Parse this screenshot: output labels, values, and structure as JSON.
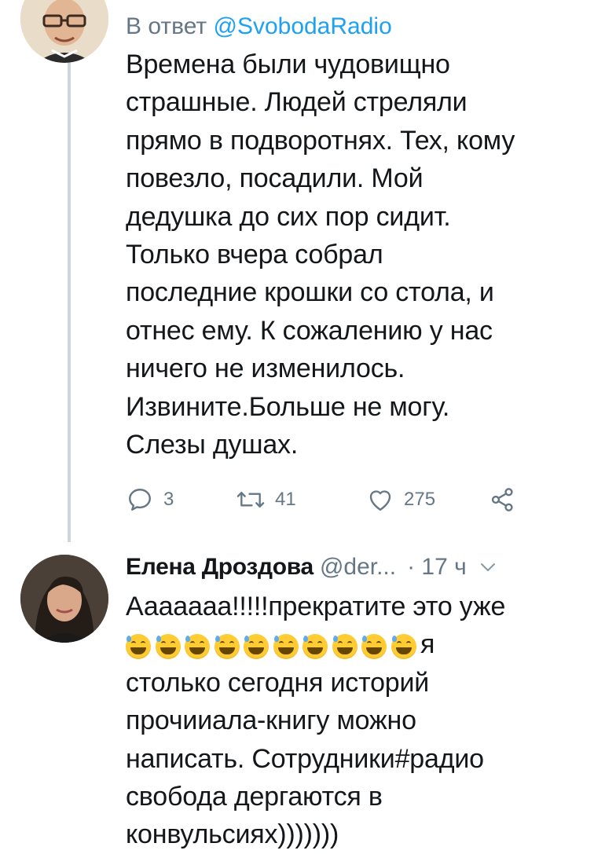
{
  "tweet1": {
    "reply_prefix": "В ответ",
    "reply_mention": "@SvobodaRadio",
    "lines": [
      "Времена были чудовищно",
      "страшные. Людей стреляли",
      "прямо в подворотнях. Тех, кому",
      "повезло, посадили. Мой",
      "дедушка до сих пор сидит.",
      "Только вчера собрал",
      "последние крошки со стола, и",
      "отнес ему. К сожалению у нас",
      "ничего не изменилось.",
      "Извините.Больше не могу.",
      "Слезы душах."
    ],
    "actions": {
      "reply_count": "3",
      "retweet_count": "41",
      "like_count": "275"
    },
    "icons": [
      "avatar-photo",
      "reply-icon",
      "retweet-icon",
      "like-icon",
      "share-icon"
    ]
  },
  "tweet2": {
    "author_name": "Елена Дроздова",
    "author_handle": "@der...",
    "time": "· 17 ч",
    "line1": "Ааааааа!!!!!прекратите это уже",
    "emoji_count": 10,
    "emoji_name": "grinning-face-with-sweat-emoji",
    "emoji_tail": "я",
    "lines": [
      "столько сегодня историй",
      "прочииала-книгу можно",
      "написать. Сотрудники#радио",
      "свобода дергаются в",
      "конвульсиях)))))))"
    ],
    "icons": [
      "avatar-photo",
      "chevron-down-icon"
    ]
  },
  "colors": {
    "text": "#14171a",
    "secondary": "#657786",
    "link": "#1da1f2",
    "thread_line": "#ccd6dd"
  }
}
